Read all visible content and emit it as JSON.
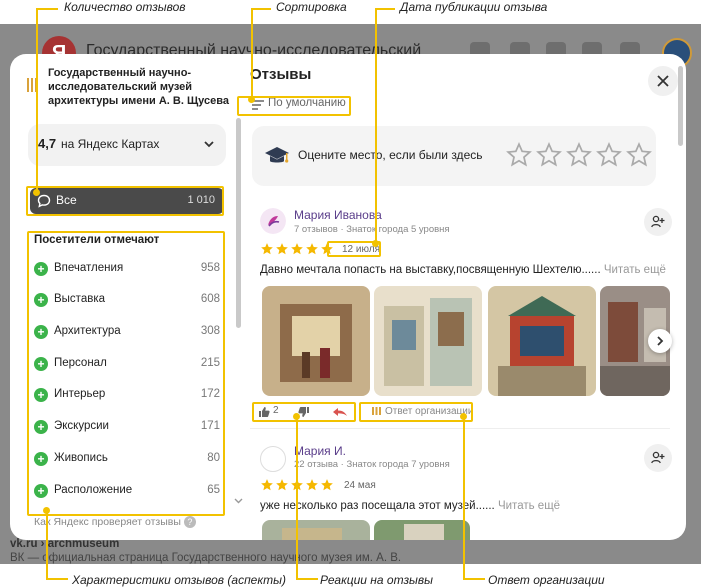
{
  "annotations": {
    "reviews_count": "Количество отзывов",
    "sorting": "Сортировка",
    "publication_date": "Дата публикации отзыва",
    "aspects": "Характеристики отзывов (аспекты)",
    "reactions": "Реакции на отзывы",
    "org_reply": "Ответ организации"
  },
  "browser": {
    "logo_letter": "Я",
    "search_query": "Государственный научно-исследовательский",
    "result_source": "vk.ru › archmuseum",
    "result_snippet": "ВК — официальная страница Государственного научного музея им. А. В."
  },
  "sidebar": {
    "org_name": "Государственный научно-исследовательский музей архитектуры имени А. В. Щусева",
    "rating_value": "4,7",
    "rating_label": "на Яндекс Картах",
    "all_label": "Все",
    "all_count": "1 010",
    "aspects_title": "Посетители отмечают",
    "aspects": [
      {
        "name": "Впечатления",
        "count": "958"
      },
      {
        "name": "Выставка",
        "count": "608"
      },
      {
        "name": "Архитектура",
        "count": "308"
      },
      {
        "name": "Персонал",
        "count": "215"
      },
      {
        "name": "Интерьер",
        "count": "172"
      },
      {
        "name": "Экскурсии",
        "count": "171"
      },
      {
        "name": "Живопись",
        "count": "80"
      },
      {
        "name": "Расположение",
        "count": "65"
      }
    ],
    "check_note": "Как Яндекс проверяет отзывы"
  },
  "reviews": {
    "title": "Отзывы",
    "sort_label": "По умолчанию",
    "rate_prompt": "Оцените место, если были здесь",
    "items": [
      {
        "name": "Мария Иванова",
        "meta": "7 отзывов · Знаток города 5 уровня",
        "rating": 5,
        "date": "12 июля",
        "text": "Давно мечтала попасть на выставку,посвященную Шехтелю......",
        "read_more": "Читать ещё",
        "likes": "2",
        "org_reply": "Ответ организации"
      },
      {
        "name": "Мария И.",
        "meta": "22 отзыва · Знаток города 7 уровня",
        "rating": 5,
        "date": "24 мая",
        "text": "уже несколько раз посещала этот музей......",
        "read_more": "Читать ещё"
      }
    ]
  },
  "colors": {
    "accent": "#f2c200",
    "star": "#f5b800",
    "positive": "#3bb34a",
    "selected_dark": "#4a4a4a"
  }
}
